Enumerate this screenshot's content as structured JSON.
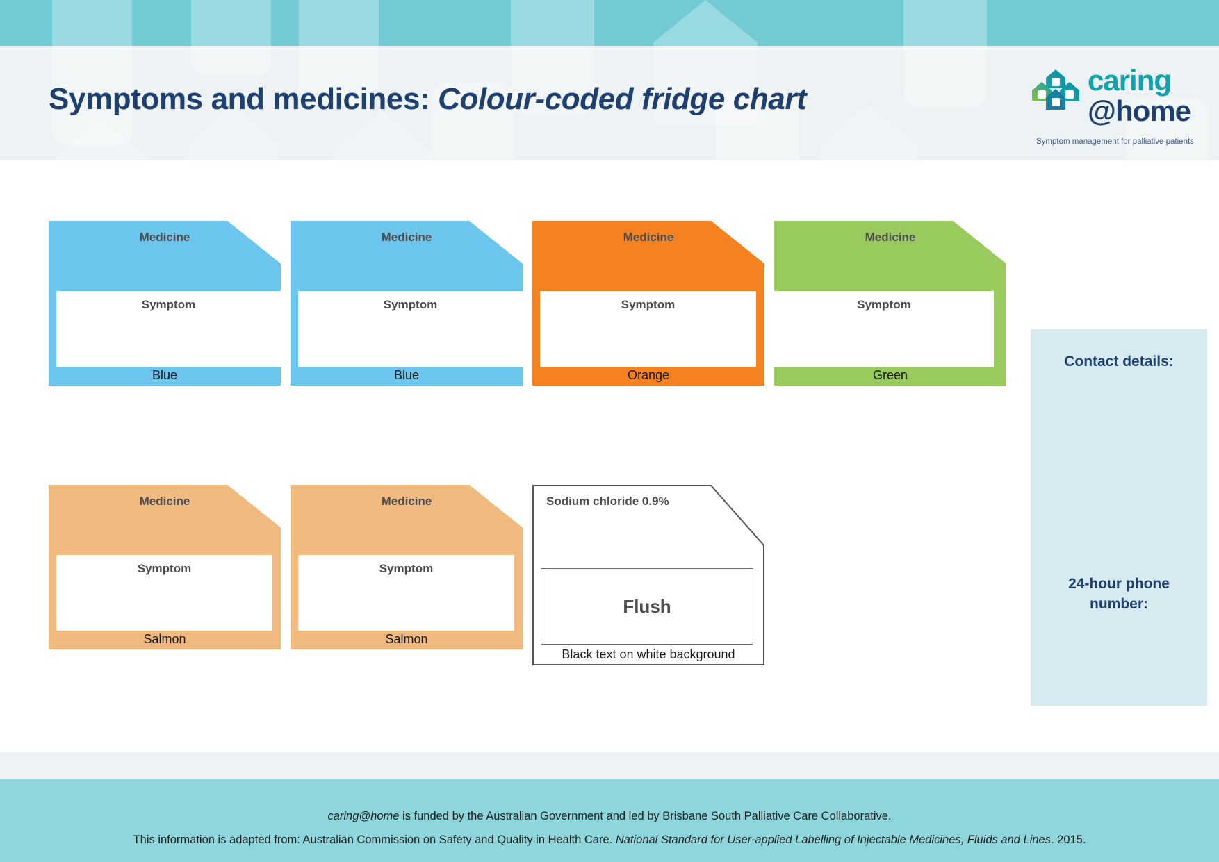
{
  "header": {
    "title_plain": "Symptoms and medicines: ",
    "title_emphasis": "Colour-coded fridge chart",
    "logo": {
      "mark_name": "caring-at-home-logo-mark",
      "word_top": "caring",
      "word_bottom": "@home",
      "tagline": "Symptom management for palliative patients",
      "colors": {
        "teal": "#10a2ad",
        "navy": "#1d3f72",
        "green": "#8dc63f"
      }
    }
  },
  "labels": {
    "medicine": "Medicine",
    "symptom": "Symptom"
  },
  "cards": [
    {
      "colour_name": "Blue",
      "colour_hex": "#6cc5ed",
      "medicine_label": "Medicine",
      "symptom_label": "Symptom",
      "row": 1,
      "col": 1
    },
    {
      "colour_name": "Blue",
      "colour_hex": "#6cc5ed",
      "medicine_label": "Medicine",
      "symptom_label": "Symptom",
      "row": 1,
      "col": 2
    },
    {
      "colour_name": "Orange",
      "colour_hex": "#f58220",
      "medicine_label": "Medicine",
      "symptom_label": "Symptom",
      "row": 1,
      "col": 3
    },
    {
      "colour_name": "Green",
      "colour_hex": "#98ca5e",
      "medicine_label": "Medicine",
      "symptom_label": "Symptom",
      "row": 1,
      "col": 4
    },
    {
      "colour_name": "Salmon",
      "colour_hex": "#f0b97f",
      "medicine_label": "Medicine",
      "symptom_label": "Symptom",
      "row": 2,
      "col": 1
    },
    {
      "colour_name": "Salmon",
      "colour_hex": "#f0b97f",
      "medicine_label": "Medicine",
      "symptom_label": "Symptom",
      "row": 2,
      "col": 2
    }
  ],
  "flush_card": {
    "title": "Sodium chloride 0.9%",
    "word": "Flush",
    "caption": "Black text on white background"
  },
  "contact_panel": {
    "heading": "Contact details:",
    "phone_line_1": "24-hour phone",
    "phone_line_2": "number:",
    "background_hex": "#d6eaf0",
    "text_hex": "#1d3f72"
  },
  "footer": {
    "line1_em": "caring@home",
    "line1_rest": " is funded by the Australian Government and led by Brisbane South Palliative Care Collaborative.",
    "line2_a": "This information is adapted from: Australian Commission on Safety and Quality in Health Care. ",
    "line2_em": "National Standard for User-applied Labelling of Injectable Medicines, Fluids and Lines",
    "line2_b": ". 2015.",
    "background_hex": "#8ed5dc"
  },
  "theme": {
    "header_band_hex": "#72cbd4",
    "header_bg_hex": "#edf2f4",
    "title_hex": "#1d3f72"
  }
}
